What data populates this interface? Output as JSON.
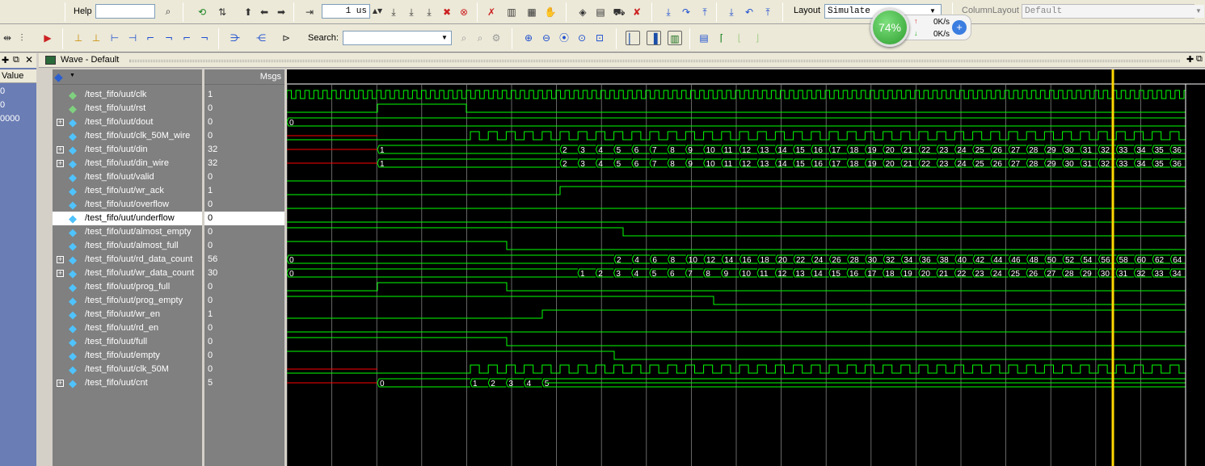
{
  "toolbar1": {
    "help_label": "Help",
    "time_value": "1 us",
    "layout_label": "Layout",
    "layout_value": "Simulate",
    "column_layout_label": "ColumnLayout",
    "column_layout_value": "Default"
  },
  "toolbar2": {
    "search_label": "Search:"
  },
  "net_monitor": {
    "percent": "74%",
    "up_speed": "0K/s",
    "down_speed": "0K/s"
  },
  "left_panel": {
    "column_header": "Value",
    "values": [
      "0",
      "0",
      "0000"
    ]
  },
  "wave_window": {
    "title": "Wave - Default",
    "msgs_header": "Msgs"
  },
  "signals": [
    {
      "name": "/test_fifo/uut/clk",
      "value": "1",
      "expandable": false,
      "icon": "input-signal-icon"
    },
    {
      "name": "/test_fifo/uut/rst",
      "value": "0",
      "expandable": false,
      "icon": "input-signal-icon"
    },
    {
      "name": "/test_fifo/uut/dout",
      "value": "0",
      "expandable": true,
      "icon": "output-bus-icon"
    },
    {
      "name": "/test_fifo/uut/clk_50M_wire",
      "value": "0",
      "expandable": false,
      "icon": "wire-signal-icon"
    },
    {
      "name": "/test_fifo/uut/din",
      "value": "32",
      "expandable": true,
      "icon": "wire-signal-icon"
    },
    {
      "name": "/test_fifo/uut/din_wire",
      "value": "32",
      "expandable": true,
      "icon": "wire-signal-icon"
    },
    {
      "name": "/test_fifo/uut/valid",
      "value": "0",
      "expandable": false,
      "icon": "wire-signal-icon"
    },
    {
      "name": "/test_fifo/uut/wr_ack",
      "value": "1",
      "expandable": false,
      "icon": "wire-signal-icon"
    },
    {
      "name": "/test_fifo/uut/overflow",
      "value": "0",
      "expandable": false,
      "icon": "wire-signal-icon"
    },
    {
      "name": "/test_fifo/uut/underflow",
      "value": "0",
      "expandable": false,
      "icon": "wire-signal-icon"
    },
    {
      "name": "/test_fifo/uut/almost_empty",
      "value": "0",
      "expandable": false,
      "icon": "wire-signal-icon"
    },
    {
      "name": "/test_fifo/uut/almost_full",
      "value": "0",
      "expandable": false,
      "icon": "wire-signal-icon"
    },
    {
      "name": "/test_fifo/uut/rd_data_count",
      "value": "56",
      "expandable": true,
      "icon": "wire-signal-icon"
    },
    {
      "name": "/test_fifo/uut/wr_data_count",
      "value": "30",
      "expandable": true,
      "icon": "wire-signal-icon"
    },
    {
      "name": "/test_fifo/uut/prog_full",
      "value": "0",
      "expandable": false,
      "icon": "wire-signal-icon"
    },
    {
      "name": "/test_fifo/uut/prog_empty",
      "value": "0",
      "expandable": false,
      "icon": "wire-signal-icon"
    },
    {
      "name": "/test_fifo/uut/wr_en",
      "value": "1",
      "expandable": false,
      "icon": "wire-signal-icon"
    },
    {
      "name": "/test_fifo/uut/rd_en",
      "value": "0",
      "expandable": false,
      "icon": "wire-signal-icon"
    },
    {
      "name": "/test_fifo/uut/full",
      "value": "0",
      "expandable": false,
      "icon": "wire-signal-icon"
    },
    {
      "name": "/test_fifo/uut/empty",
      "value": "0",
      "expandable": false,
      "icon": "wire-signal-icon"
    },
    {
      "name": "/test_fifo/uut/clk_50M",
      "value": "0",
      "expandable": false,
      "icon": "wire-signal-icon"
    },
    {
      "name": "/test_fifo/uut/cnt",
      "value": "5",
      "expandable": true,
      "icon": "wire-signal-icon"
    }
  ],
  "selected_signal_index": 9,
  "bus_labels": {
    "dout": [
      "0"
    ],
    "din": [
      "1",
      "2",
      "3",
      "4",
      "5",
      "6",
      "7",
      "8",
      "9",
      "10",
      "11",
      "12",
      "13",
      "14",
      "15",
      "16",
      "17",
      "18",
      "19",
      "20",
      "21",
      "22",
      "23",
      "24",
      "25",
      "26",
      "27",
      "28",
      "29",
      "30",
      "31",
      "32",
      "33",
      "34",
      "35",
      "36"
    ],
    "din_wire": [
      "1",
      "2",
      "3",
      "4",
      "5",
      "6",
      "7",
      "8",
      "9",
      "10",
      "11",
      "12",
      "13",
      "14",
      "15",
      "16",
      "17",
      "18",
      "19",
      "20",
      "21",
      "22",
      "23",
      "24",
      "25",
      "26",
      "27",
      "28",
      "29",
      "30",
      "31",
      "32",
      "33",
      "34",
      "35",
      "36"
    ],
    "rd_data_count": [
      "0",
      "2",
      "4",
      "6",
      "8",
      "10",
      "12",
      "14",
      "16",
      "18",
      "20",
      "22",
      "24",
      "26",
      "28",
      "30",
      "32",
      "34",
      "36",
      "38",
      "40",
      "42",
      "44",
      "46",
      "48",
      "50",
      "52",
      "54",
      "56",
      "58",
      "60",
      "62",
      "64"
    ],
    "wr_data_count": [
      "0",
      "1",
      "2",
      "3",
      "4",
      "5",
      "6",
      "7",
      "8",
      "9",
      "10",
      "11",
      "12",
      "13",
      "14",
      "15",
      "16",
      "17",
      "18",
      "19",
      "20",
      "21",
      "22",
      "23",
      "24",
      "25",
      "26",
      "27",
      "28",
      "29",
      "30",
      "31",
      "32",
      "33",
      "34"
    ],
    "cnt": [
      "0",
      "1",
      "2",
      "3",
      "4",
      "5"
    ]
  },
  "colors": {
    "wave": "#00ff00",
    "undefined_wave": "#ff0000",
    "cursor": "#ffd700",
    "background": "#000000",
    "grid": "#808080"
  }
}
